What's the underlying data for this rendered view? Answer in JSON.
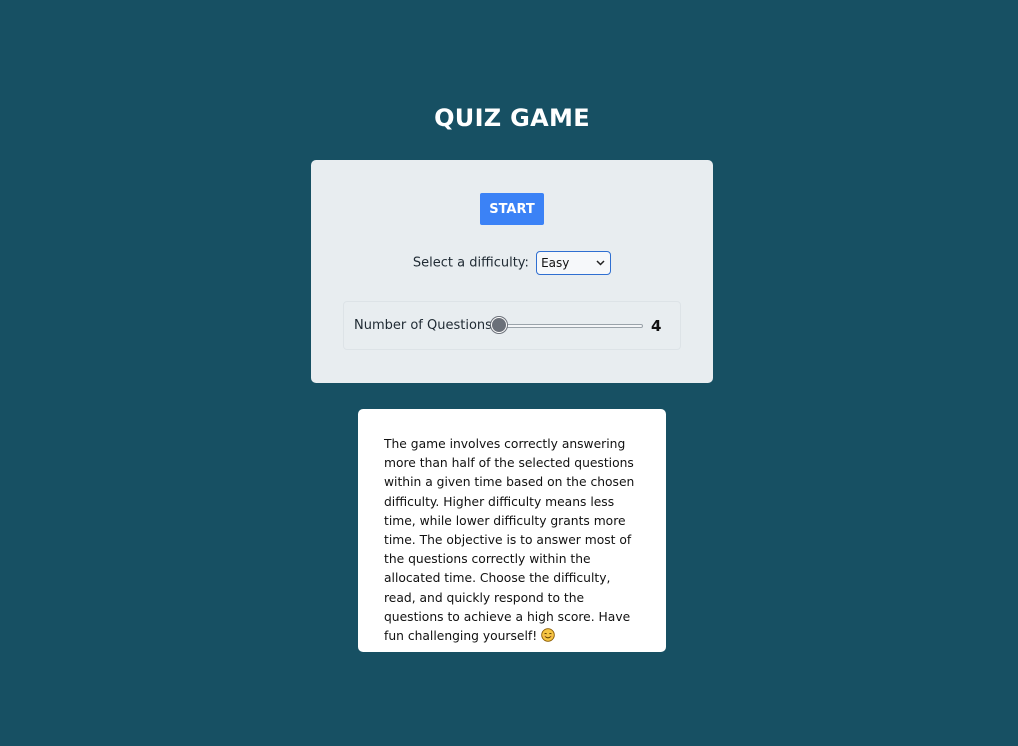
{
  "header": {
    "title": "QUIZ GAME"
  },
  "controls": {
    "start_label": "START",
    "difficulty_label": "Select a difficulty:",
    "difficulty_selected": "Easy",
    "questions_label": "Number of Questions:",
    "questions_value": "4",
    "questions_slider_fraction": 0.0
  },
  "info": {
    "text": "The game involves correctly answering more than half of the selected questions within a given time based on the chosen difficulty. Higher difficulty means less time, while lower difficulty grants more time. The objective is to answer most of the questions correctly within the allocated time. Choose the difficulty, read, and quickly respond to the questions to achieve a high score. Have fun challenging yourself!",
    "emoji_icon": "smiling-face-icon"
  },
  "colors": {
    "background": "#175063",
    "panel": "#e8edf0",
    "accent": "#3b82f6"
  }
}
